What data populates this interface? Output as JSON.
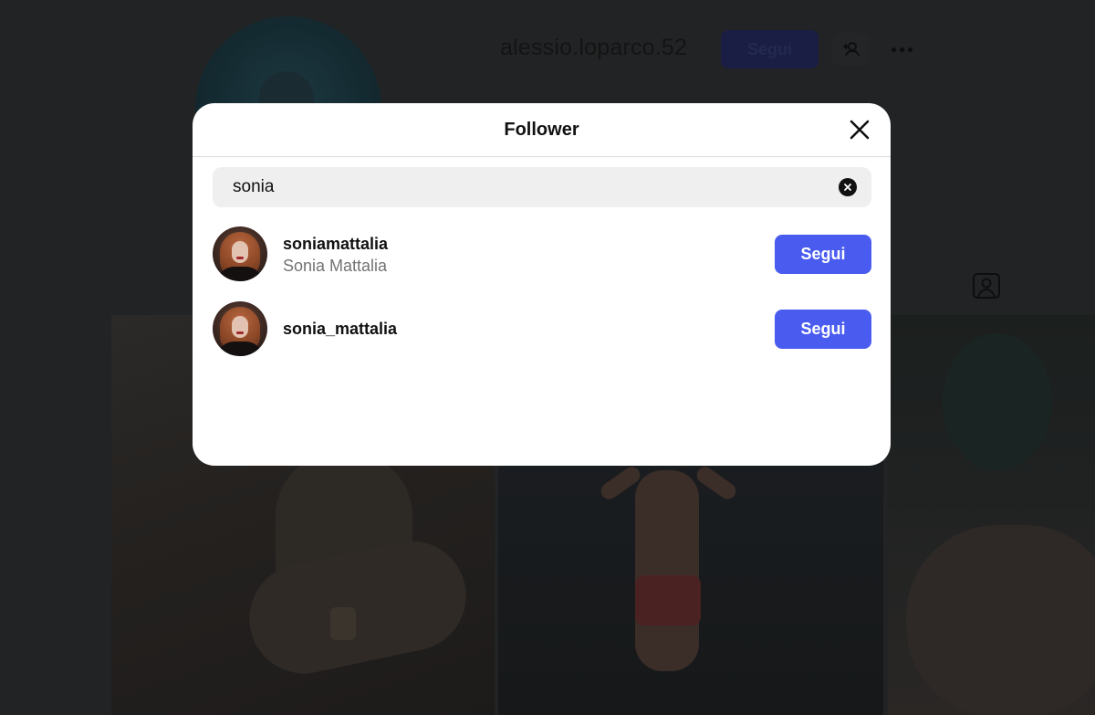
{
  "profile": {
    "username": "alessio.loparco.52",
    "follow_label": "Segui"
  },
  "modal": {
    "title": "Follower",
    "search": {
      "value": "sonia"
    },
    "results": [
      {
        "username": "soniamattalia",
        "full_name": "Sonia Mattalia",
        "follow_label": "Segui"
      },
      {
        "username": "sonia_mattalia",
        "full_name": "",
        "follow_label": "Segui"
      }
    ]
  },
  "colors": {
    "accent": "#4a5cf0",
    "overlay": "#1f1f20",
    "secondary_text": "#737373"
  },
  "icons": [
    "close-icon",
    "clear-search-icon",
    "add-person-icon",
    "more-options-icon",
    "tagged-icon"
  ]
}
